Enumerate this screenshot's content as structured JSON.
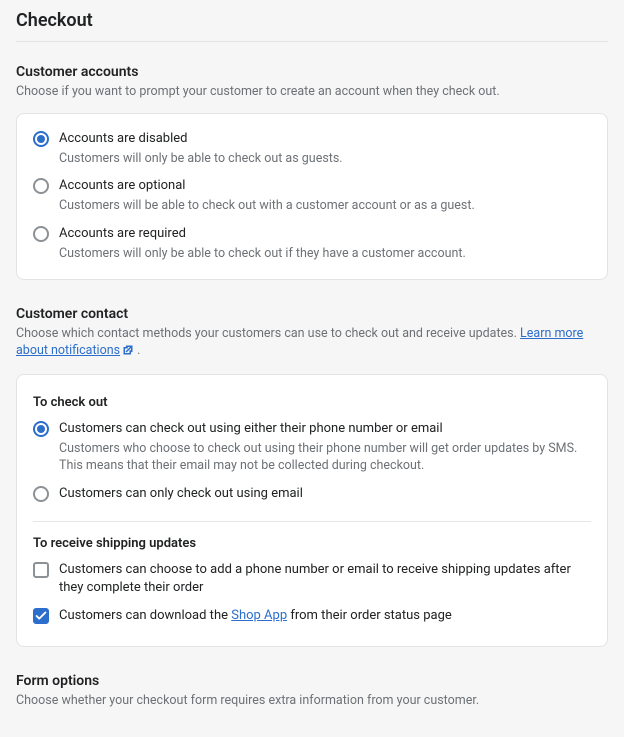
{
  "page": {
    "title": "Checkout"
  },
  "accounts": {
    "title": "Customer accounts",
    "desc": "Choose if you want to prompt your customer to create an account when they check out.",
    "options": [
      {
        "label": "Accounts are disabled",
        "sub": "Customers will only be able to check out as guests."
      },
      {
        "label": "Accounts are optional",
        "sub": "Customers will be able to check out with a customer account or as a guest."
      },
      {
        "label": "Accounts are required",
        "sub": "Customers will only be able to check out if they have a customer account."
      }
    ]
  },
  "contact": {
    "title": "Customer contact",
    "desc_prefix": "Choose which contact methods your customers can use to check out and receive updates. ",
    "link_text": "Learn more about notifications",
    "desc_suffix": " .",
    "checkout_heading": "To check out",
    "checkout_options": [
      {
        "label": "Customers can check out using either their phone number or email",
        "sub": "Customers who choose to check out using their phone number will get order updates by SMS. This means that their email may not be collected during checkout."
      },
      {
        "label": "Customers can only check out using email"
      }
    ],
    "shipping_heading": "To receive shipping updates",
    "shipping_options": [
      {
        "label": "Customers can choose to add a phone number or email to receive shipping updates after they complete their order"
      },
      {
        "label_prefix": "Customers can download the ",
        "link": "Shop App",
        "label_suffix": " from their order status page"
      }
    ]
  },
  "form": {
    "title": "Form options",
    "desc": "Choose whether your checkout form requires extra information from your customer."
  }
}
